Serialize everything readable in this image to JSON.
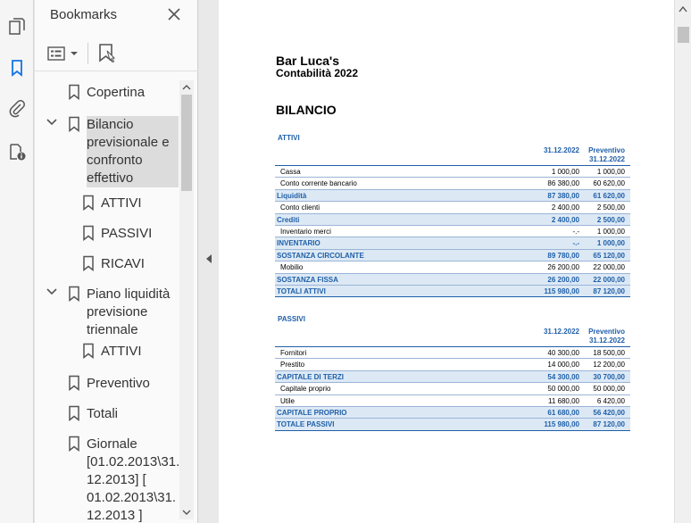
{
  "panel": {
    "title": "Bookmarks"
  },
  "bookmarks": [
    {
      "label": "Copertina",
      "level": 0,
      "expandable": false
    },
    {
      "label": "Bilancio\nprevisionale e\nconfronto\neffettivo",
      "level": 0,
      "expandable": true,
      "selected": true
    },
    {
      "label": "ATTIVI",
      "level": 1,
      "expandable": false
    },
    {
      "label": "PASSIVI",
      "level": 1,
      "expandable": false
    },
    {
      "label": "RICAVI",
      "level": 1,
      "expandable": false
    },
    {
      "label": "Piano liquidità\nprevisione\ntriennale",
      "level": 0,
      "expandable": true
    },
    {
      "label": "ATTIVI",
      "level": 1,
      "expandable": false
    },
    {
      "label": "Preventivo",
      "level": 0,
      "expandable": false
    },
    {
      "label": "Totali",
      "level": 0,
      "expandable": false
    },
    {
      "label": "Giornale\n[01.02.2013\\31.\n12.2013]  [\n01.02.2013\\31.\n12.2013 ]",
      "level": 0,
      "expandable": false
    }
  ],
  "document": {
    "title": "Bar Luca's",
    "subtitle": "Contabilità 2022",
    "section": "BILANCIO",
    "col1": "31.12.2022",
    "col2": "Preventivo\n31.12.2022",
    "attivi": {
      "caption": "ATTIVI",
      "rows": [
        {
          "label": "Cassa",
          "v1": "1 000,00",
          "v2": "1 000,00",
          "total": false
        },
        {
          "label": "Conto corrente bancario",
          "v1": "86 380,00",
          "v2": "60 620,00",
          "total": false
        },
        {
          "label": "Liquidità",
          "v1": "87 380,00",
          "v2": "61 620,00",
          "total": true
        },
        {
          "label": "Conto clienti",
          "v1": "2 400,00",
          "v2": "2 500,00",
          "total": false
        },
        {
          "label": "Crediti",
          "v1": "2 400,00",
          "v2": "2 500,00",
          "total": true
        },
        {
          "label": "Inventario merci",
          "v1": "-.-",
          "v2": "1 000,00",
          "total": false
        },
        {
          "label": "INVENTARIO",
          "v1": "-.-",
          "v2": "1 000,00",
          "total": true
        },
        {
          "label": "SOSTANZA CIRCOLANTE",
          "v1": "89 780,00",
          "v2": "65 120,00",
          "total": true
        },
        {
          "label": "Mobilio",
          "v1": "26 200,00",
          "v2": "22 000,00",
          "total": false
        },
        {
          "label": "SOSTANZA FISSA",
          "v1": "26 200,00",
          "v2": "22 000,00",
          "total": true
        },
        {
          "label": "TOTALI ATTIVI",
          "v1": "115 980,00",
          "v2": "87 120,00",
          "total": true,
          "final": true
        }
      ]
    },
    "passivi": {
      "caption": "PASSIVI",
      "rows": [
        {
          "label": "Fornitori",
          "v1": "40 300,00",
          "v2": "18 500,00",
          "total": false
        },
        {
          "label": "Prestito",
          "v1": "14 000,00",
          "v2": "12 200,00",
          "total": false
        },
        {
          "label": "CAPITALE DI TERZI",
          "v1": "54 300,00",
          "v2": "30 700,00",
          "total": true
        },
        {
          "label": "Capitale proprio",
          "v1": "50 000,00",
          "v2": "50 000,00",
          "total": false
        },
        {
          "label": "Utile",
          "v1": "11 680,00",
          "v2": "6 420,00",
          "total": false
        },
        {
          "label": "CAPITALE PROPRIO",
          "v1": "61 680,00",
          "v2": "56 420,00",
          "total": true
        },
        {
          "label": "TOTALE PASSIVI",
          "v1": "115 980,00",
          "v2": "87 120,00",
          "total": true,
          "final": true
        }
      ]
    }
  },
  "colors": {
    "accent": "#1f5fa8",
    "highlight": "#dce9f5",
    "selection": "#dcdcdc",
    "rail_active": "#1473e6"
  }
}
